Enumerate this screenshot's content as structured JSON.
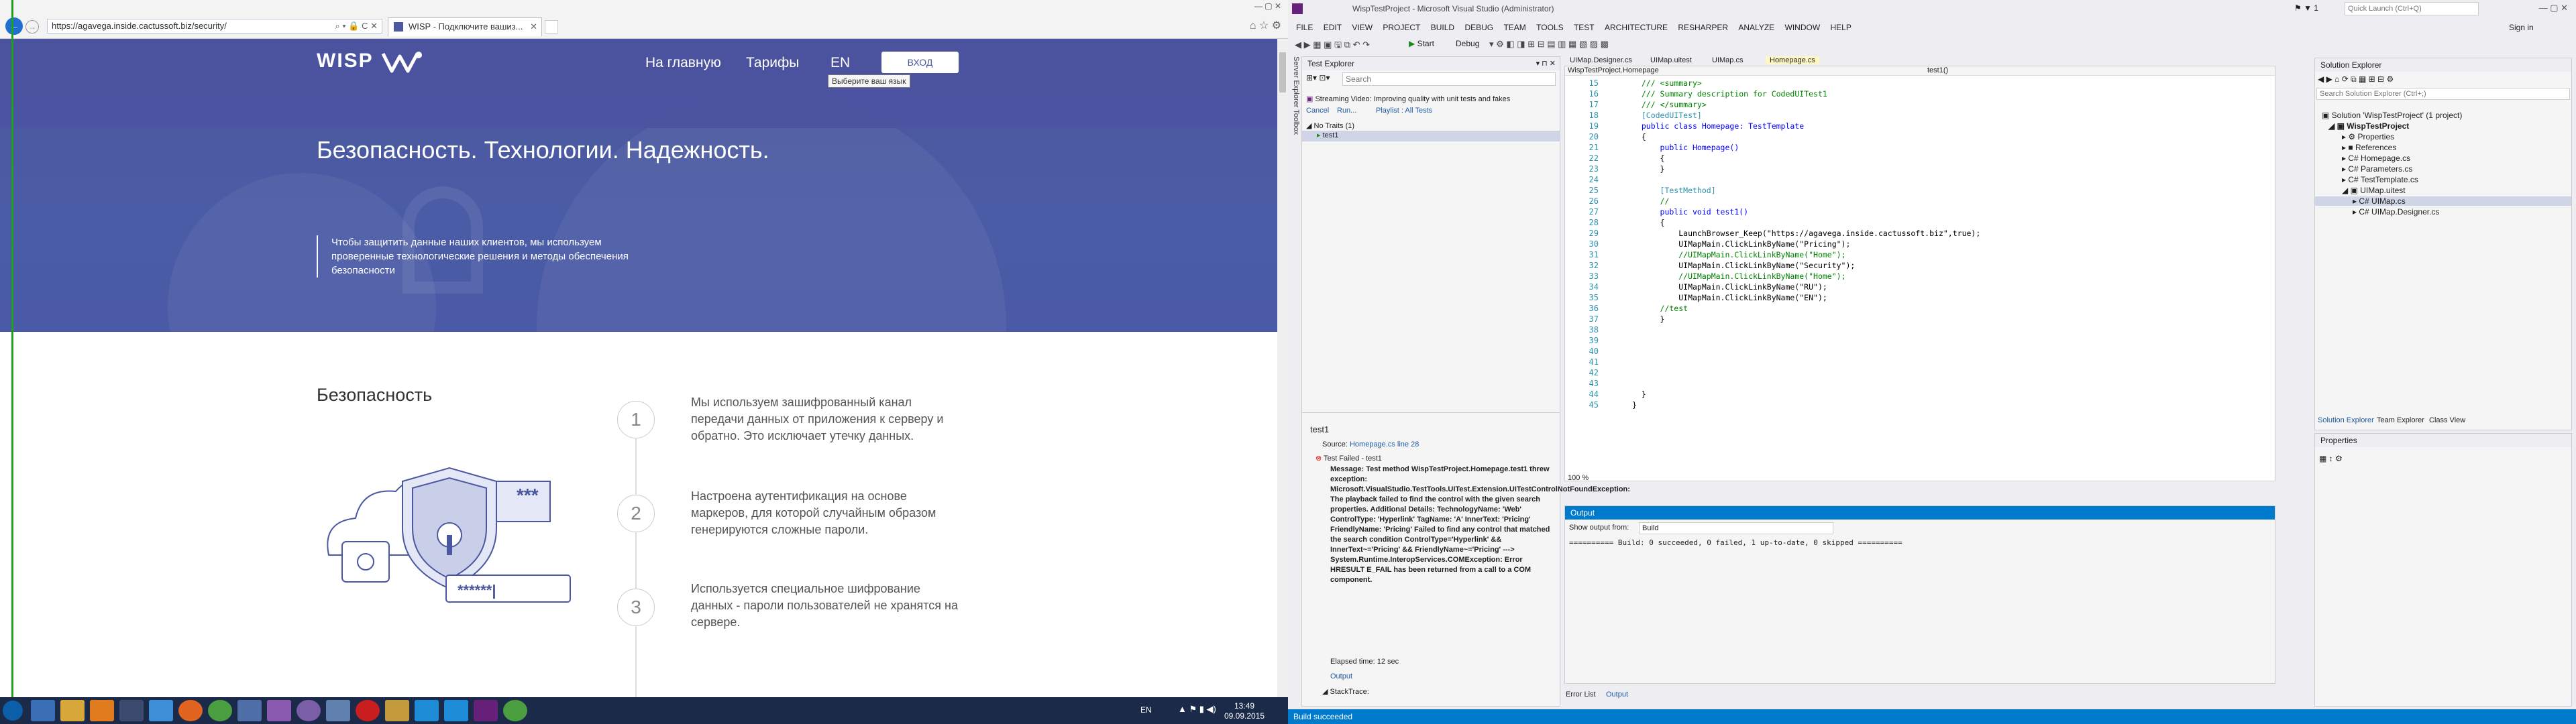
{
  "browser": {
    "url": "https://agavega.inside.cactussoft.biz/security/",
    "tab_label": "WISP - Подключите вашиз..."
  },
  "site": {
    "logo": "WISP",
    "nav": [
      "На главную",
      "Тарифы",
      "EN"
    ],
    "login": "ВХОД",
    "tooltip": "Выберите ваш язык",
    "hero_title": "Безопасность. Технологии. Надежность.",
    "hero_text": "Чтобы защитить данные наших клиентов, мы используем проверенные технологические решения и методы обеспечения безопасности",
    "section_title": "Безопасность",
    "stars": "***",
    "password_dots": "******|",
    "steps": [
      {
        "n": "1",
        "text": "Мы используем зашифрованный канал передачи данных от приложения к серверу и обратно. Это исключает утечку данных."
      },
      {
        "n": "2",
        "text": "Настроена аутентификация на основе маркеров, для которой случайным образом генерируются сложные пароли."
      },
      {
        "n": "3",
        "text": "Используется специальное шифрование данных - пароли пользователей не хранятся на сервере."
      }
    ]
  },
  "taskbar": {
    "lang": "EN",
    "time": "13:49",
    "date": "09.09.2015"
  },
  "vs": {
    "title": "WispTestProject - Microsoft Visual Studio (Administrator)",
    "menu": [
      "FILE",
      "EDIT",
      "VIEW",
      "PROJECT",
      "BUILD",
      "DEBUG",
      "TEAM",
      "TOOLS",
      "TEST",
      "ARCHITECTURE",
      "RESHARPER",
      "ANALYZE",
      "WINDOW",
      "HELP"
    ],
    "quick_launch": "Quick Launch (Ctrl+Q)",
    "sign_in": "Sign in",
    "start": "Start",
    "config": "Debug",
    "test_explorer": {
      "title": "Test Explorer",
      "search": "Search",
      "banner": "Streaming Video: Improving quality with unit tests and fakes",
      "cancel": "Cancel",
      "run": "Run...",
      "playlist": "Playlist : All Tests",
      "group": "No Traits (1)",
      "test": "test1",
      "detail_title": "test1",
      "source_label": "Source:",
      "source_link": "Homepage.cs line 28",
      "failed": "Test Failed - test1",
      "message": "Message: Test method WispTestProject.Homepage.test1 threw exception: Microsoft.VisualStudio.TestTools.UITest.Extension.UITestControlNotFoundException: The playback failed to find the control with the given search properties. Additional Details: TechnologyName: 'Web' ControlType: 'Hyperlink' TagName: 'A' InnerText: 'Pricing' FriendlyName: 'Pricing' Failed to find any control that matched the search condition ControlType='Hyperlink' && InnerText~='Pricing' && FriendlyName~='Pricing' ---> System.Runtime.InteropServices.COMException: Error HRESULT E_FAIL has been returned from a call to a COM component.",
      "elapsed": "Elapsed time: 12 sec",
      "output": "Output",
      "stacktrace": "StackTrace:"
    },
    "tabs": [
      "UIMap.Designer.cs",
      "UIMap.uitest",
      "UIMap.cs",
      "Homepage.cs"
    ],
    "nav_left": "WispTestProject.Homepage",
    "nav_right": "test1()",
    "code": [
      {
        "n": "15",
        "t": "  /// <summary>"
      },
      {
        "n": "16",
        "t": "  /// Summary description for CodedUITest1"
      },
      {
        "n": "17",
        "t": "  /// </summary>"
      },
      {
        "n": "18",
        "t": "  [CodedUITest]"
      },
      {
        "n": "19",
        "t": "  public class Homepage: TestTemplate"
      },
      {
        "n": "20",
        "t": "  {"
      },
      {
        "n": "21",
        "t": "      public Homepage()"
      },
      {
        "n": "22",
        "t": "      {"
      },
      {
        "n": "23",
        "t": "      }"
      },
      {
        "n": "24",
        "t": ""
      },
      {
        "n": "25",
        "t": "      [TestMethod]"
      },
      {
        "n": "26",
        "t": "      //"
      },
      {
        "n": "27",
        "t": "      public void test1()"
      },
      {
        "n": "28",
        "t": "      {"
      },
      {
        "n": "29",
        "t": "          LaunchBrowser_Keep(\"https://agavega.inside.cactussoft.biz\",true);"
      },
      {
        "n": "30",
        "t": "          UIMapMain.ClickLinkByName(\"Pricing\");"
      },
      {
        "n": "31",
        "t": "          //UIMapMain.ClickLinkByName(\"Home\");"
      },
      {
        "n": "32",
        "t": "          UIMapMain.ClickLinkByName(\"Security\");"
      },
      {
        "n": "33",
        "t": "          //UIMapMain.ClickLinkByName(\"Home\");"
      },
      {
        "n": "34",
        "t": "          UIMapMain.ClickLinkByName(\"RU\");"
      },
      {
        "n": "35",
        "t": "          UIMapMain.ClickLinkByName(\"EN\");"
      },
      {
        "n": "36",
        "t": "      //test"
      },
      {
        "n": "37",
        "t": "      }"
      },
      {
        "n": "38",
        "t": ""
      },
      {
        "n": "39",
        "t": ""
      },
      {
        "n": "40",
        "t": ""
      },
      {
        "n": "41",
        "t": ""
      },
      {
        "n": "42",
        "t": ""
      },
      {
        "n": "43",
        "t": ""
      },
      {
        "n": "44",
        "t": "  }"
      },
      {
        "n": "45",
        "t": "}"
      }
    ],
    "zoom": "100 %",
    "output": {
      "title": "Output",
      "show_from": "Show output from:",
      "source": "Build",
      "text": "========== Build: 0 succeeded, 0 failed, 1 up-to-date, 0 skipped =========="
    },
    "bottom_tabs": [
      "Error List",
      "Output"
    ],
    "solution": {
      "title": "Solution Explorer",
      "search": "Search Solution Explorer (Ctrl+;)",
      "items": [
        "Solution 'WispTestProject' (1 project)",
        "WispTestProject",
        "Properties",
        "References",
        "Homepage.cs",
        "Parameters.cs",
        "TestTemplate.cs",
        "UIMap.uitest",
        "UIMap.cs",
        "UIMap.Designer.cs"
      ],
      "tabs": [
        "Solution Explorer",
        "Team Explorer",
        "Class View"
      ]
    },
    "properties": "Properties",
    "status": "Build succeeded"
  }
}
